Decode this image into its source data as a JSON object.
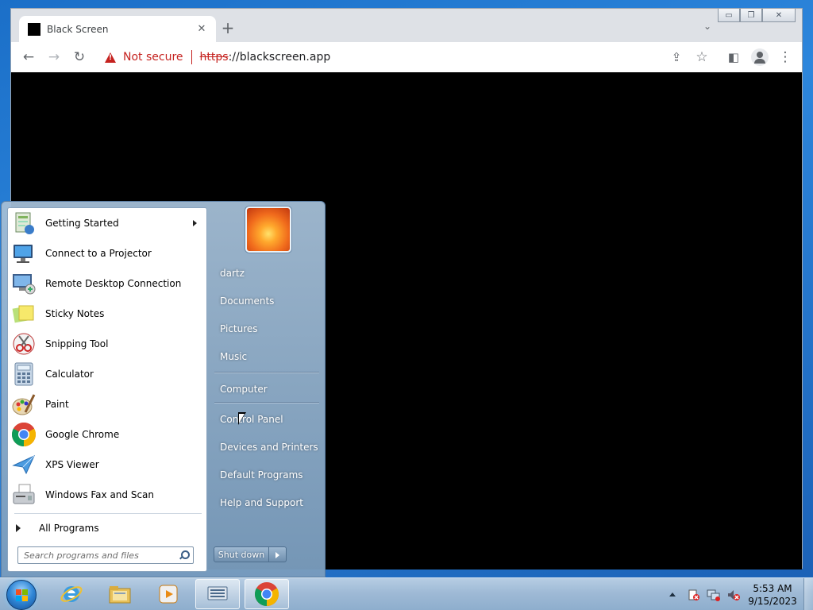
{
  "browser": {
    "tab_title": "Black Screen",
    "tab_close": "✕",
    "new_tab": "+",
    "tab_search": "⌄",
    "window_controls": {
      "minimize": "▭",
      "restore": "❐",
      "close": "✕"
    },
    "nav": {
      "back": "←",
      "forward": "→",
      "reload": "↻"
    },
    "omnibox": {
      "security_label": "Not secure",
      "url_scheme": "https",
      "url_separator": "://",
      "url_host": "blackscreen.app"
    },
    "toolbar_icons": {
      "share": "⇪",
      "bookmark": "☆",
      "side_panel": "◧",
      "menu": "⋮"
    }
  },
  "start_menu": {
    "programs": [
      {
        "label": "Getting Started",
        "icon": "getting-started-icon",
        "has_submenu": true
      },
      {
        "label": "Connect to a Projector",
        "icon": "projector-icon"
      },
      {
        "label": "Remote Desktop Connection",
        "icon": "remote-desktop-icon"
      },
      {
        "label": "Sticky Notes",
        "icon": "sticky-notes-icon"
      },
      {
        "label": "Snipping Tool",
        "icon": "snipping-tool-icon"
      },
      {
        "label": "Calculator",
        "icon": "calculator-icon"
      },
      {
        "label": "Paint",
        "icon": "paint-icon"
      },
      {
        "label": "Google Chrome",
        "icon": "chrome-icon"
      },
      {
        "label": "XPS Viewer",
        "icon": "xps-viewer-icon"
      },
      {
        "label": "Windows Fax and Scan",
        "icon": "fax-scan-icon"
      }
    ],
    "all_programs": "All Programs",
    "search_placeholder": "Search programs and files",
    "right_items": [
      "dartz",
      "Documents",
      "Pictures",
      "Music",
      "Computer",
      "Control Panel",
      "Devices and Printers",
      "Default Programs",
      "Help and Support"
    ],
    "shutdown_label": "Shut down"
  },
  "taskbar": {
    "apps": [
      "internet-explorer-icon",
      "file-explorer-icon",
      "media-player-icon",
      "keyboard-app-icon",
      "chrome-icon"
    ],
    "tray_icons": [
      "action-center-icon",
      "network-icon",
      "volume-muted-icon"
    ],
    "time": "5:53 AM",
    "date": "9/15/2023"
  },
  "colors": {
    "not_secure_red": "#c5221f",
    "page_background": "#000000",
    "desktop_blue": "#1b6fc8"
  }
}
